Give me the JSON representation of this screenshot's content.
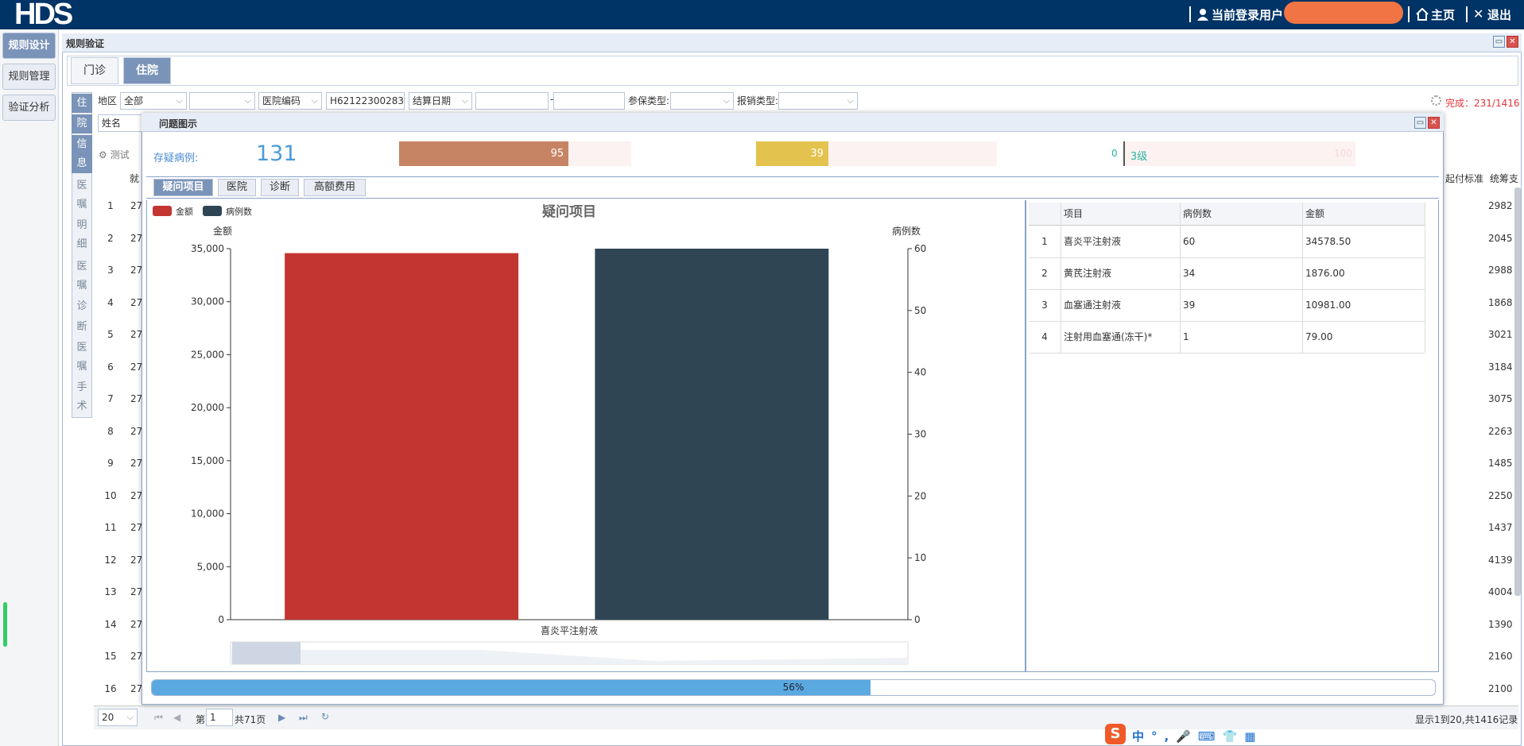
{
  "header": {
    "logo": "HDS",
    "user_label": "当前登录用户",
    "home_label": "主页",
    "logout_label": "退出",
    "bg_color": "#003366"
  },
  "left_nav": {
    "items": [
      {
        "label": "规则设计",
        "active": true
      },
      {
        "label": "规则管理",
        "active": false
      },
      {
        "label": "验证分析",
        "active": false
      }
    ]
  },
  "panel": {
    "title": "规则验证",
    "tabs": [
      {
        "label": "门诊",
        "active": false
      },
      {
        "label": "住院",
        "active": true
      }
    ]
  },
  "side_sections": [
    "住",
    "院",
    "信",
    "息",
    "医",
    "嘱",
    "明",
    "细",
    "医",
    "嘱",
    "诊",
    "断",
    "医",
    "嘱",
    "手",
    "术"
  ],
  "filters": {
    "region_label": "地区",
    "region_value": "全部",
    "hospital_code_value": "医院编码",
    "hospital_code_input": "H62122300283",
    "settle_date_label": "结算日期",
    "date_sep": "-",
    "insurance_type_label": "参保类型:",
    "claim_type_label": "报销类型:",
    "name_label": "姓名",
    "status": "完成：231/1416"
  },
  "bg_grid": {
    "toolbar_label": "测试",
    "col_header": "就",
    "right_headers": [
      "起付标准",
      "统筹支"
    ],
    "row_numbers": [
      "1",
      "2",
      "3",
      "4",
      "5",
      "6",
      "7",
      "8",
      "9",
      "10",
      "11",
      "12",
      "13",
      "14",
      "15",
      "16"
    ],
    "row_prefix": "27",
    "right_values": [
      "2982",
      "2045",
      "2988",
      "1868",
      "3021",
      "3184",
      "3075",
      "2263",
      "1485",
      "2250",
      "1437",
      "4139",
      "4004",
      "1390",
      "2160",
      "2100"
    ]
  },
  "pager": {
    "page_size": "20",
    "page_prefix": "第",
    "page_value": "1",
    "page_total": "共71页",
    "summary": "显示1到20,共1416记录"
  },
  "modal": {
    "title": "问题图示",
    "stat_label": "存疑病例:",
    "stat_value": "131",
    "bars": [
      {
        "value": "95",
        "fraction": 0.73,
        "color": "#c68464"
      },
      {
        "value": "39",
        "fraction": 0.3,
        "color": "#e3c24e"
      },
      {
        "value": "0",
        "fraction": 0.0,
        "color": "#2bb5a0"
      }
    ],
    "bar3_label": "3级",
    "bar3_faint": "100",
    "sub_tabs": [
      {
        "label": "疑问项目",
        "active": true
      },
      {
        "label": "医院",
        "active": false
      },
      {
        "label": "诊断",
        "active": false
      },
      {
        "label": "高额费用",
        "active": false
      }
    ],
    "table": {
      "headers": [
        "项目",
        "病例数",
        "金额"
      ],
      "rows": [
        {
          "idx": "1",
          "item": "喜炎平注射液",
          "cases": "60",
          "amount": "34578.50"
        },
        {
          "idx": "2",
          "item": "黄芪注射液",
          "cases": "34",
          "amount": "1876.00"
        },
        {
          "idx": "3",
          "item": "血塞通注射液",
          "cases": "39",
          "amount": "10981.00"
        },
        {
          "idx": "4",
          "item": "注射用血塞通(冻干)*",
          "cases": "1",
          "amount": "79.00"
        }
      ]
    },
    "progress": {
      "fraction": 0.56,
      "label": "56%"
    }
  },
  "chart_data": {
    "type": "bar",
    "title": "疑问项目",
    "categories": [
      "喜炎平注射液"
    ],
    "series": [
      {
        "name": "金额",
        "values": [
          34578.5
        ],
        "color": "#c23531",
        "axis": "left"
      },
      {
        "name": "病例数",
        "values": [
          60
        ],
        "color": "#2f4554",
        "axis": "right"
      }
    ],
    "ylabel": "金额",
    "y2label": "病例数",
    "ylim": [
      0,
      35000
    ],
    "y2lim": [
      0,
      60
    ],
    "yticks": [
      "0",
      "5,000",
      "10,000",
      "15,000",
      "20,000",
      "25,000",
      "30,000",
      "35,000"
    ],
    "y2ticks": [
      "0",
      "10",
      "20",
      "30",
      "40",
      "50",
      "60"
    ],
    "legend": "top-left",
    "grid": false
  }
}
